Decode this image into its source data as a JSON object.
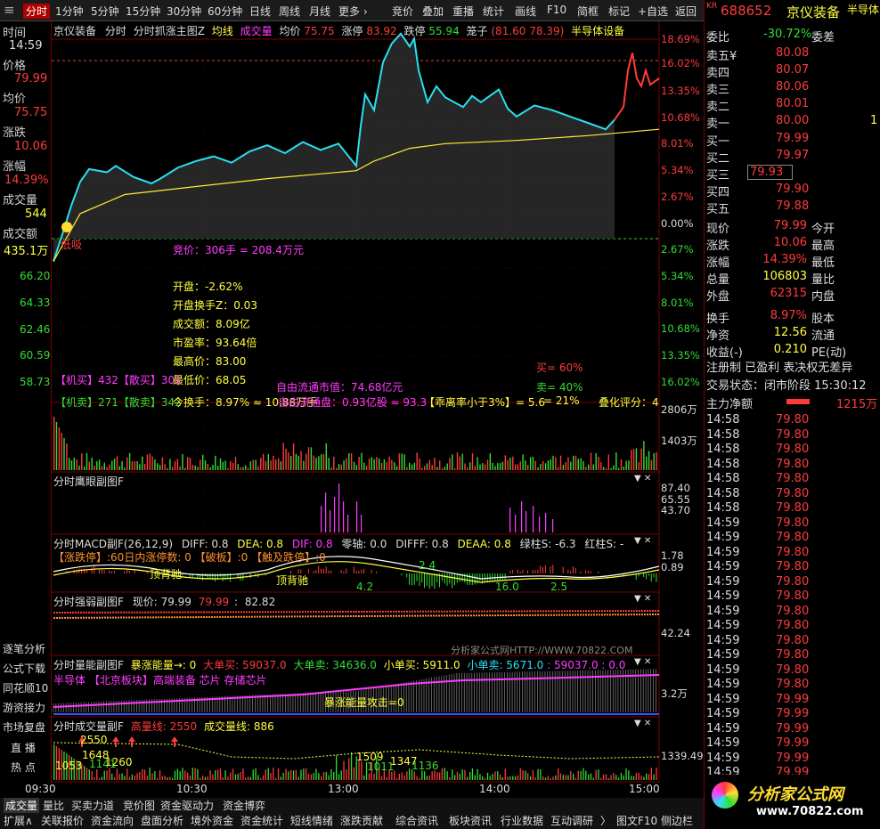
{
  "toolbar": {
    "items": [
      "分时",
      "1分钟",
      "5分钟",
      "15分钟",
      "30分钟",
      "60分钟",
      "日线",
      "周线",
      "月线",
      "更多 ›"
    ],
    "right": [
      "竞价",
      "叠加",
      "重播",
      "统计",
      "画线",
      "F10",
      "简框",
      "标记",
      "+自选",
      "返回"
    ]
  },
  "stock": {
    "market_tag": "KR",
    "code": "688652",
    "name": "京仪装备",
    "sector_tag": "半导体"
  },
  "left_info": {
    "time_label": "时间",
    "time": "14:59",
    "price_label": "价格",
    "price": "79.99",
    "avg_label": "均价",
    "avg": "75.75",
    "change_label": "涨跌",
    "change": "10.06",
    "pct_label": "涨幅",
    "pct": "14.39%",
    "vol_label": "成交量",
    "vol": "544",
    "amt_label": "成交额",
    "amt": "435.1万",
    "price_scale": [
      "66.20",
      "64.33",
      "62.46",
      "60.59",
      "58.73"
    ]
  },
  "main_header": {
    "name": "京仪装备",
    "tf": "分时",
    "indicator": "分时抓涨主图Z",
    "ma": "均线",
    "vol": "成交量",
    "avg_label": "均价",
    "avg": "75.75",
    "zt_label": "涨停",
    "zt": "83.92",
    "dt_label": "跌停",
    "dt": "55.94",
    "box_label": "笼子",
    "box": "(81.60 78.39)",
    "sector": "半导体设备"
  },
  "pct_scale": [
    "18.69%",
    "16.02%",
    "13.35%",
    "10.68%",
    "8.01%",
    "5.34%",
    "2.67%",
    "0.00%",
    "2.67%",
    "5.34%",
    "8.01%",
    "10.68%",
    "13.35%",
    "16.02%"
  ],
  "overlay": {
    "bid": "竞价：306手 = 208.4万元",
    "lines": [
      [
        "开盘：",
        "-2.62%"
      ],
      [
        "开盘换手Z：",
        "0.03"
      ],
      [
        "成交额：",
        "8.09亿"
      ],
      [
        "市盈率：",
        "93.64倍"
      ],
      [
        "最高价：",
        "83.00"
      ],
      [
        "最低价：",
        "68.05"
      ]
    ],
    "inst_buy": "【机买】432【散买】301",
    "inst_sell": "【机卖】271【散卖】342",
    "turnover": "今换手：8.97% ≈ 10.88万手",
    "float_mv": "自由流通市值：74.68亿元",
    "real_float": "自由流通盘：0.93亿股 ≈ 93.3",
    "low_rate": "【乖离率小于3%】= 5.6",
    "buy_pct": "买= 60%",
    "sell_pct": "卖= 40%",
    "mid_pct": "= 21%",
    "score": "叠化评分：4",
    "label_cheap": "低吸",
    "label_dbl": "双爆"
  },
  "vol_scale": [
    "2806万",
    "1403万"
  ],
  "sub1": {
    "title": "分时鹰眼副图F",
    "scale": [
      "87.40",
      "65.55",
      "43.70"
    ]
  },
  "sub2": {
    "title": "分时MACD副F(26,12,9)",
    "diff": "DIFF: 0.8",
    "dea": "DEA: 0.8",
    "dif": "DIF: 0.8",
    "zero": "零轴: 0.0",
    "diffd": "DIFFF: 0.8",
    "deaa": "DEAA: 0.8",
    "green": "绿柱S: -6.3",
    "red": "红柱S: -",
    "row2": "【涨跌停】:60日内涨停数: 0 【破板】:0 【触及跌停】:0",
    "scale": [
      "1.78",
      "0.89"
    ],
    "marks": [
      "顶背驰",
      "顶背驰",
      "2.4",
      "4.2",
      "16.0",
      "2.5"
    ]
  },
  "sub3": {
    "title": "分时强弱副图F",
    "now": "现价: 79.99",
    "v1": "79.99",
    "v2": "82.82",
    "scale": [
      "42.24"
    ]
  },
  "sub4": {
    "title": "分时量能副图F",
    "burst": "暴涨能量→: 0",
    "big_buy": "大单买: 59037.0",
    "big_sell": "大单卖: 34636.0",
    "small_buy": "小单买: 5911.0",
    "small_sell": "小单卖: 5671.0",
    "tail": ": 59037.0 : 0.0",
    "row2": "半导体 【北京板块】高端装备 芯片 存储芯片",
    "scale": [
      "3.2万"
    ],
    "mark": "暴涨能量攻击=0",
    "watermark": "分析家公式网HTTP://WWW.70822.COM"
  },
  "sub5": {
    "title": "分时成交量副F",
    "high": "高量线: 2550",
    "vol": "成交量线: 886",
    "scale": [
      "1339.49"
    ],
    "labels": [
      "2550",
      "1053",
      "1648",
      "1141",
      "1260",
      "1509",
      "1011",
      "1347",
      "1136"
    ]
  },
  "time_axis": [
    "09:30",
    "10:30",
    "13:00",
    "14:00",
    "15:00"
  ],
  "left_buttons": [
    "逐笔分析",
    "公式下载",
    "同花顺10",
    "游资接力",
    "市场复盘"
  ],
  "live": {
    "a": "直 播",
    "b": "热 点"
  },
  "bottom_tabs": [
    "成交量",
    "量比",
    "买卖力道",
    "竞价图",
    "资金驱动力",
    "资金博弈"
  ],
  "bottom_tabs2": [
    "扩展∧",
    "关联报价",
    "资金流向",
    "盘面分析",
    "境外资金",
    "资金统计",
    "短线情绪",
    "涨跌贡献",
    "综合资讯",
    "板块资讯",
    "行业数据",
    "互动调研",
    "〉",
    "图文F10",
    "侧边栏"
  ],
  "orderbook": {
    "wb_label": "委比",
    "wb": "-30.72%",
    "wc_label": "委差",
    "sells": [
      [
        "卖五",
        "¥",
        "80.08"
      ],
      [
        "卖四",
        "",
        "80.07"
      ],
      [
        "卖三",
        "",
        "80.06"
      ],
      [
        "卖二",
        "",
        "80.01"
      ],
      [
        "卖一",
        "",
        "80.00",
        "1"
      ]
    ],
    "buys": [
      [
        "买一",
        "79.99"
      ],
      [
        "买二",
        "79.97"
      ],
      [
        "买三",
        "79.93"
      ],
      [
        "买四",
        "79.90"
      ],
      [
        "买五",
        "79.88"
      ]
    ]
  },
  "quote": [
    [
      "现价",
      "79.99",
      "今开",
      ""
    ],
    [
      "涨跌",
      "10.06",
      "最高",
      ""
    ],
    [
      "涨幅",
      "14.39%",
      "最低",
      ""
    ],
    [
      "总量",
      "106803",
      "量比",
      ""
    ],
    [
      "外盘",
      "62315",
      "内盘",
      ""
    ],
    [
      "换手",
      "8.97%",
      "股本",
      ""
    ],
    [
      "净资",
      "12.56",
      "流通",
      ""
    ],
    [
      "收益(-)",
      "0.210",
      "PE(动)",
      ""
    ]
  ],
  "status": {
    "a": "注册制 已盈利 表决权无差异",
    "b": "交易状态：闭市阶段 15:30:12",
    "flow_label": "主力净额",
    "flow": "1215万"
  },
  "ticks": [
    [
      "14:58",
      "79.80"
    ],
    [
      "14:58",
      "79.80"
    ],
    [
      "14:58",
      "79.80"
    ],
    [
      "14:58",
      "79.80"
    ],
    [
      "14:58",
      "79.80"
    ],
    [
      "14:58",
      "79.80"
    ],
    [
      "14:58",
      "79.80"
    ],
    [
      "14:59",
      "79.80"
    ],
    [
      "14:59",
      "79.80"
    ],
    [
      "14:59",
      "79.80"
    ],
    [
      "14:59",
      "79.80"
    ],
    [
      "14:59",
      "79.80"
    ],
    [
      "14:59",
      "79.80"
    ],
    [
      "14:59",
      "79.80"
    ],
    [
      "14:59",
      "79.80"
    ],
    [
      "14:59",
      "79.80"
    ],
    [
      "14:59",
      "79.80"
    ],
    [
      "14:59",
      "79.80"
    ],
    [
      "14:59",
      "79.80"
    ],
    [
      "14:59",
      "79.99"
    ],
    [
      "14:59",
      "79.99"
    ],
    [
      "14:59",
      "79.99"
    ],
    [
      "14:59",
      "79.99"
    ],
    [
      "14:59",
      "79.99"
    ],
    [
      "14:59",
      "79.99"
    ],
    [
      "14:59",
      "79.99"
    ],
    [
      "15:00",
      "79.99"
    ]
  ],
  "logo": {
    "a": "分析家公式网",
    "b": "www.70822.com"
  },
  "colors": {
    "up": "#ff3b3b",
    "down": "#33dd33",
    "cyan": "#29e0f0",
    "yellow": "#ffff40",
    "magenta": "#ff3cff",
    "border": "#7a0000"
  }
}
